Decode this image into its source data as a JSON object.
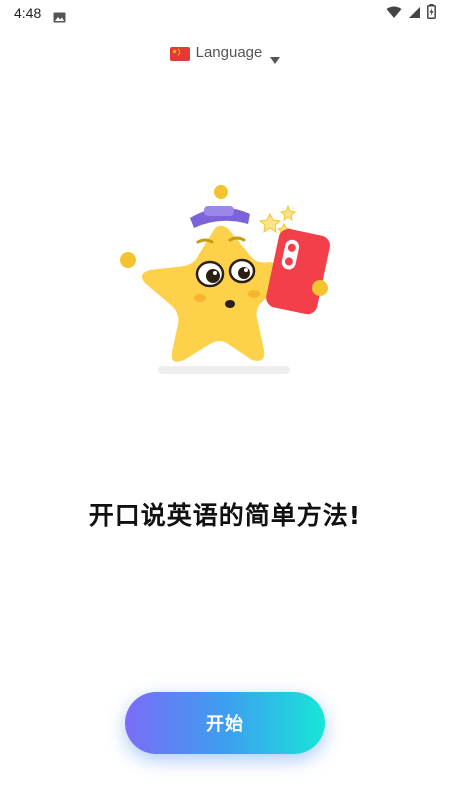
{
  "status_bar": {
    "time": "4:48",
    "icons": [
      "photo-icon",
      "wifi-icon",
      "signal-icon",
      "battery-charging-icon"
    ]
  },
  "language_selector": {
    "flag": "china-flag-icon",
    "label": "Language",
    "caret": "caret-down-icon"
  },
  "illustration": {
    "name": "star-mascot-with-phone",
    "colors": {
      "star": "#fdd24a",
      "cap": "#7d63d9",
      "phone": "#f23f4a",
      "sparkle": "#fde48a"
    }
  },
  "headline": "开口说英语的简单方法!",
  "start_button": {
    "label": "开始",
    "gradient": [
      "#7b6cf6",
      "#3d9ef0",
      "#17e6d8"
    ]
  }
}
